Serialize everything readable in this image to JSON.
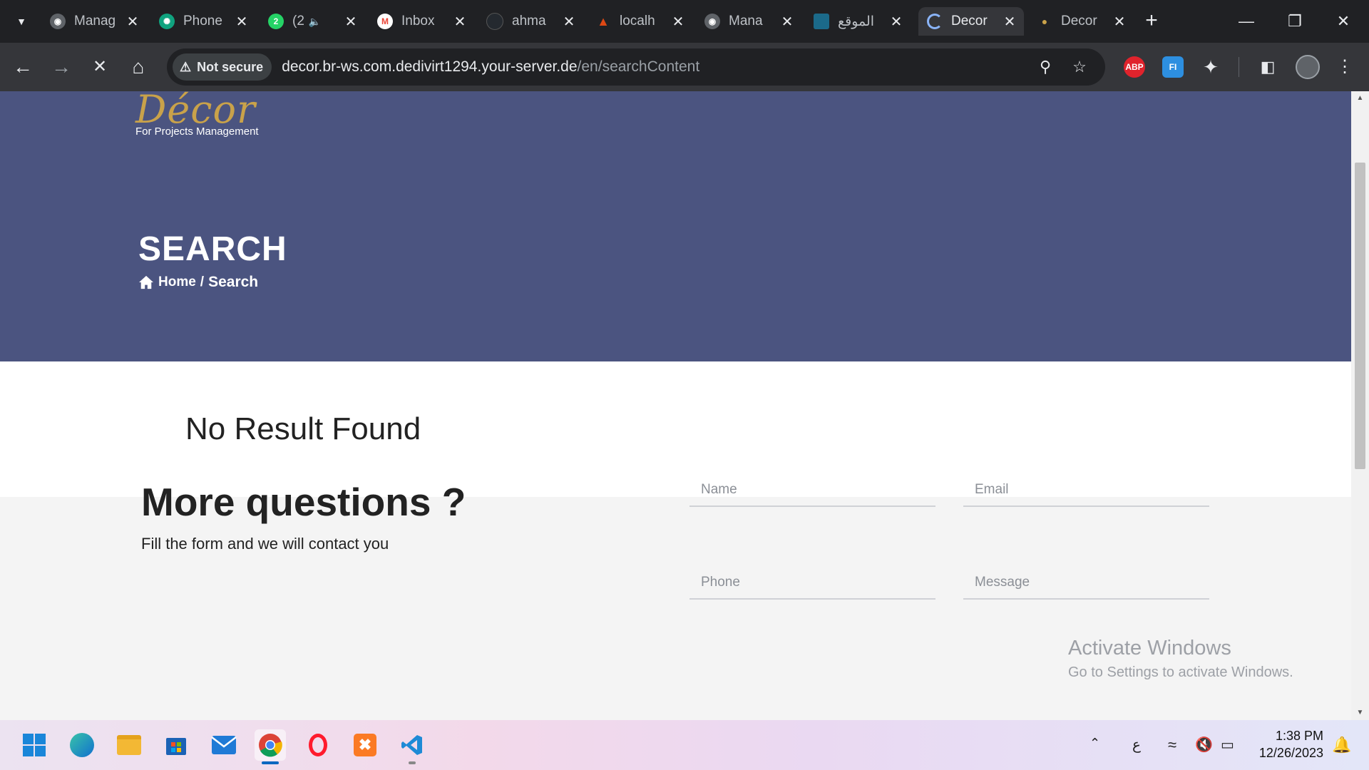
{
  "browser": {
    "tabs": [
      {
        "title": "Manag",
        "favicon": "mask-icon",
        "color": "#5f6368"
      },
      {
        "title": "Phone",
        "favicon": "chatgpt-icon",
        "color": "#10a37f"
      },
      {
        "title": "(2",
        "favicon": "whatsapp-icon",
        "color": "#25d366",
        "badge": "2",
        "audio": true
      },
      {
        "title": "Inbox",
        "favicon": "gmail-icon",
        "color": "#ea4335"
      },
      {
        "title": "ahma",
        "favicon": "github-icon",
        "color": "#24292f"
      },
      {
        "title": "localh",
        "favicon": "codeigniter-icon",
        "color": "#dd4814"
      },
      {
        "title": "Mana",
        "favicon": "mask-icon",
        "color": "#5f6368"
      },
      {
        "title": "الموقع",
        "favicon": "site-icon",
        "color": "#1b6a8a"
      },
      {
        "title": "Decor",
        "favicon": "loading-icon",
        "color": "#8ab4f8",
        "active": true
      },
      {
        "title": "Decor",
        "favicon": "decor-icon",
        "color": "#c9a24a"
      }
    ],
    "address": {
      "security_label": "Not secure",
      "host": "decor.br-ws.com.dedivirt1294.your-server.de",
      "path": "/en/searchContent"
    },
    "extensions": [
      {
        "name": "adblock-plus",
        "label": "ABP",
        "color": "#e0232c"
      },
      {
        "name": "fi-extension",
        "label": "FI",
        "color": "#2d8fe0"
      }
    ]
  },
  "site": {
    "logo_script": "Décor",
    "logo_subtitle": "For Projects Management",
    "page_title": "SEARCH",
    "breadcrumb": {
      "home": "Home",
      "separator": "/",
      "current": "Search"
    },
    "result_message": "No Result Found",
    "contact": {
      "title": "More questions ?",
      "subtitle": "Fill the form and we will contact you",
      "name_placeholder": "Name",
      "email_placeholder": "Email",
      "phone_placeholder": "Phone",
      "message_placeholder": "Message"
    },
    "colors": {
      "hero": "#4b5480",
      "logo_gold": "#c9a24a"
    }
  },
  "watermark": {
    "title": "Activate Windows",
    "subtitle": "Go to Settings to activate Windows."
  },
  "taskbar": {
    "apps": [
      "windows-start",
      "edge",
      "file-explorer",
      "microsoft-store",
      "mail",
      "chrome",
      "opera",
      "xampp",
      "vscode"
    ],
    "language": "ع",
    "time": "1:38 PM",
    "date": "12/26/2023"
  }
}
